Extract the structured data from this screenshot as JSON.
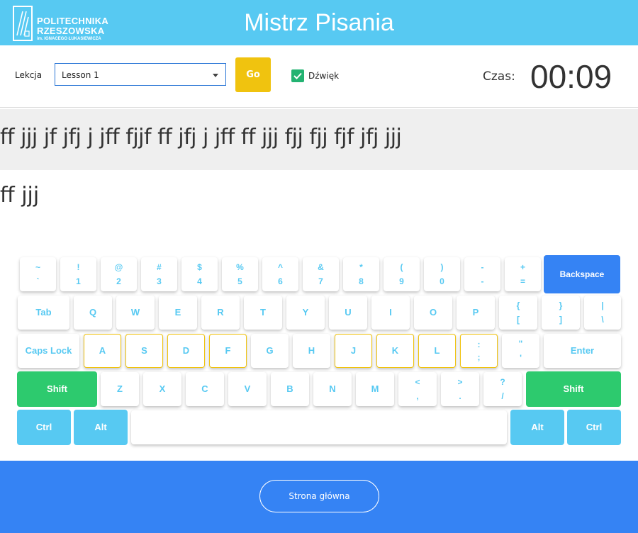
{
  "header": {
    "logo_line1": "POLITECHNIKA",
    "logo_line2": "RZESZOWSKA",
    "logo_line3": "im. IGNACEGO ŁUKASIEWICZA",
    "title": "Mistrz Pisania",
    "background_color": "#57c9f2"
  },
  "toolbar": {
    "lesson_label": "Lekcja",
    "lesson_selected": "Lesson 1",
    "go_label": "Go",
    "sound_label": "Dźwięk",
    "sound_checked": true,
    "time_label": "Czas:",
    "time_value": "00:09"
  },
  "exercise": {
    "target_text": "ff jjj jf jfj j jff fjjf ff jfj j jff ff jjj fjj fjj fjf jfj jjj",
    "typed_text": "ff jjj"
  },
  "keyboard": {
    "row1": [
      {
        "top": "~",
        "bottom": "`"
      },
      {
        "top": "!",
        "bottom": "1"
      },
      {
        "top": "@",
        "bottom": "2"
      },
      {
        "top": "#",
        "bottom": "3"
      },
      {
        "top": "$",
        "bottom": "4"
      },
      {
        "top": "%",
        "bottom": "5"
      },
      {
        "top": "^",
        "bottom": "6"
      },
      {
        "top": "&",
        "bottom": "7"
      },
      {
        "top": "*",
        "bottom": "8"
      },
      {
        "top": "(",
        "bottom": "9"
      },
      {
        "top": ")",
        "bottom": "0"
      },
      {
        "top": "-",
        "bottom": "-"
      },
      {
        "top": "+",
        "bottom": "="
      }
    ],
    "backspace": "Backspace",
    "tab": "Tab",
    "row2": [
      "Q",
      "W",
      "E",
      "R",
      "T",
      "Y",
      "U",
      "I",
      "O",
      "P"
    ],
    "row2_sym": [
      {
        "top": "{",
        "bottom": "["
      },
      {
        "top": "}",
        "bottom": "]"
      },
      {
        "top": "|",
        "bottom": "\\"
      }
    ],
    "caps": "Caps Lock",
    "row3": [
      "A",
      "S",
      "D",
      "F",
      "G",
      "H",
      "J",
      "K",
      "L"
    ],
    "row3_sym": [
      {
        "top": ":",
        "bottom": ";"
      },
      {
        "top": "\"",
        "bottom": "'"
      }
    ],
    "enter": "Enter",
    "shift_left": "Shift",
    "row4": [
      "Z",
      "X",
      "C",
      "V",
      "B",
      "N",
      "M"
    ],
    "row4_sym": [
      {
        "top": "<",
        "bottom": ","
      },
      {
        "top": ">",
        "bottom": "."
      },
      {
        "top": "?",
        "bottom": "/"
      }
    ],
    "shift_right": "Shift",
    "ctrl_left": "Ctrl",
    "alt_left": "Alt",
    "alt_right": "Alt",
    "ctrl_right": "Ctrl",
    "highlighted_keys": [
      "A",
      "S",
      "D",
      "F",
      "J",
      "K",
      "L",
      ";"
    ],
    "colors": {
      "key_text": "#57c9f2",
      "shift": "#2dca6e",
      "modifier": "#57c9f2",
      "backspace": "#3583f4",
      "home_row_border": "#f0c30f"
    }
  },
  "footer": {
    "home_button_label": "Strona główna",
    "background_color": "#3583f4"
  }
}
